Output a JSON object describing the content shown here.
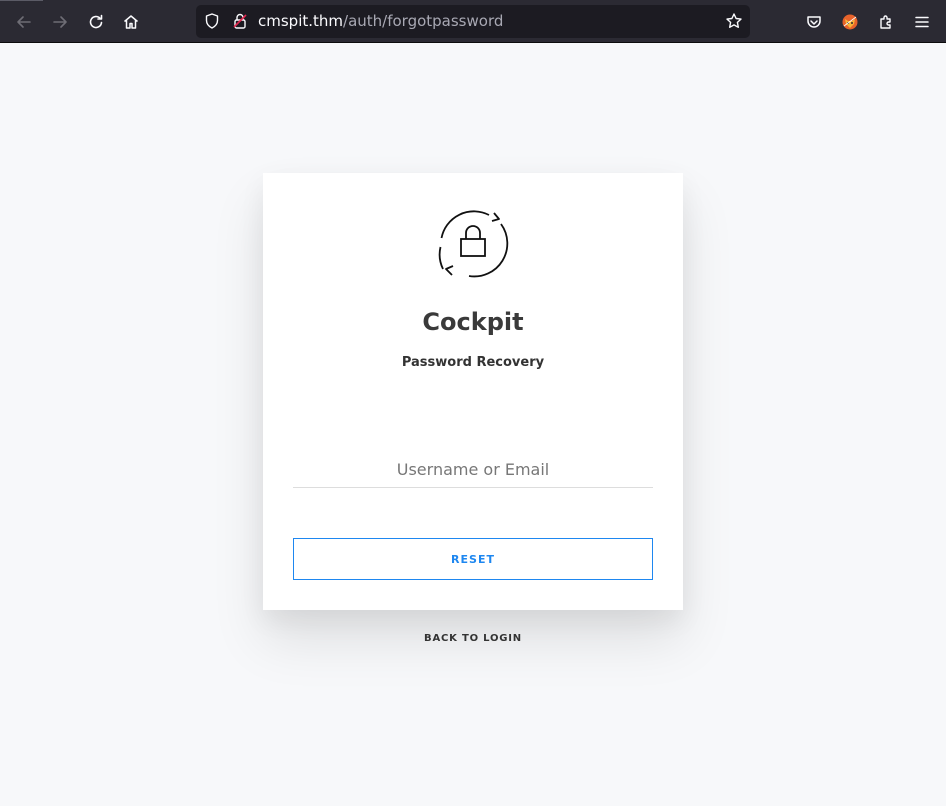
{
  "browser": {
    "url_host": "cmspit.thm",
    "url_path": "/auth/forgotpassword"
  },
  "icons": {
    "back": "arrow-left-icon",
    "forward": "arrow-right-icon",
    "reload": "reload-icon",
    "home": "home-icon",
    "shield": "shield-icon",
    "lock": "lock-icon",
    "bookmark": "star-icon",
    "pocket": "pocket-icon",
    "extension_avatar": "fox-extension-icon",
    "extensions": "puzzle-icon",
    "menu": "hamburger-menu-icon",
    "logo": "lock-refresh-icon"
  },
  "colors": {
    "accent": "#1e87f0",
    "toolbar_bg": "#2b2a33",
    "page_bg": "#f7f8fa"
  },
  "page": {
    "app_name": "Cockpit",
    "subtitle": "Password Recovery",
    "input_placeholder": "Username or Email",
    "input_value": "",
    "reset_label": "RESET",
    "back_label": "BACK TO LOGIN"
  }
}
